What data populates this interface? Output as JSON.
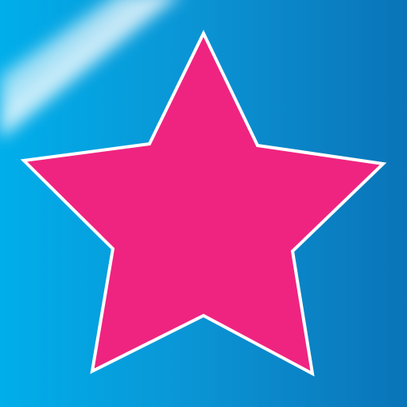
{
  "icon": {
    "name": "star-icon",
    "colors": {
      "background_start": "#06a6e6",
      "background_end": "#0a73b8",
      "star_fill": "#ef2480",
      "star_stroke": "#ffffff",
      "shine": "#ffffff"
    }
  }
}
